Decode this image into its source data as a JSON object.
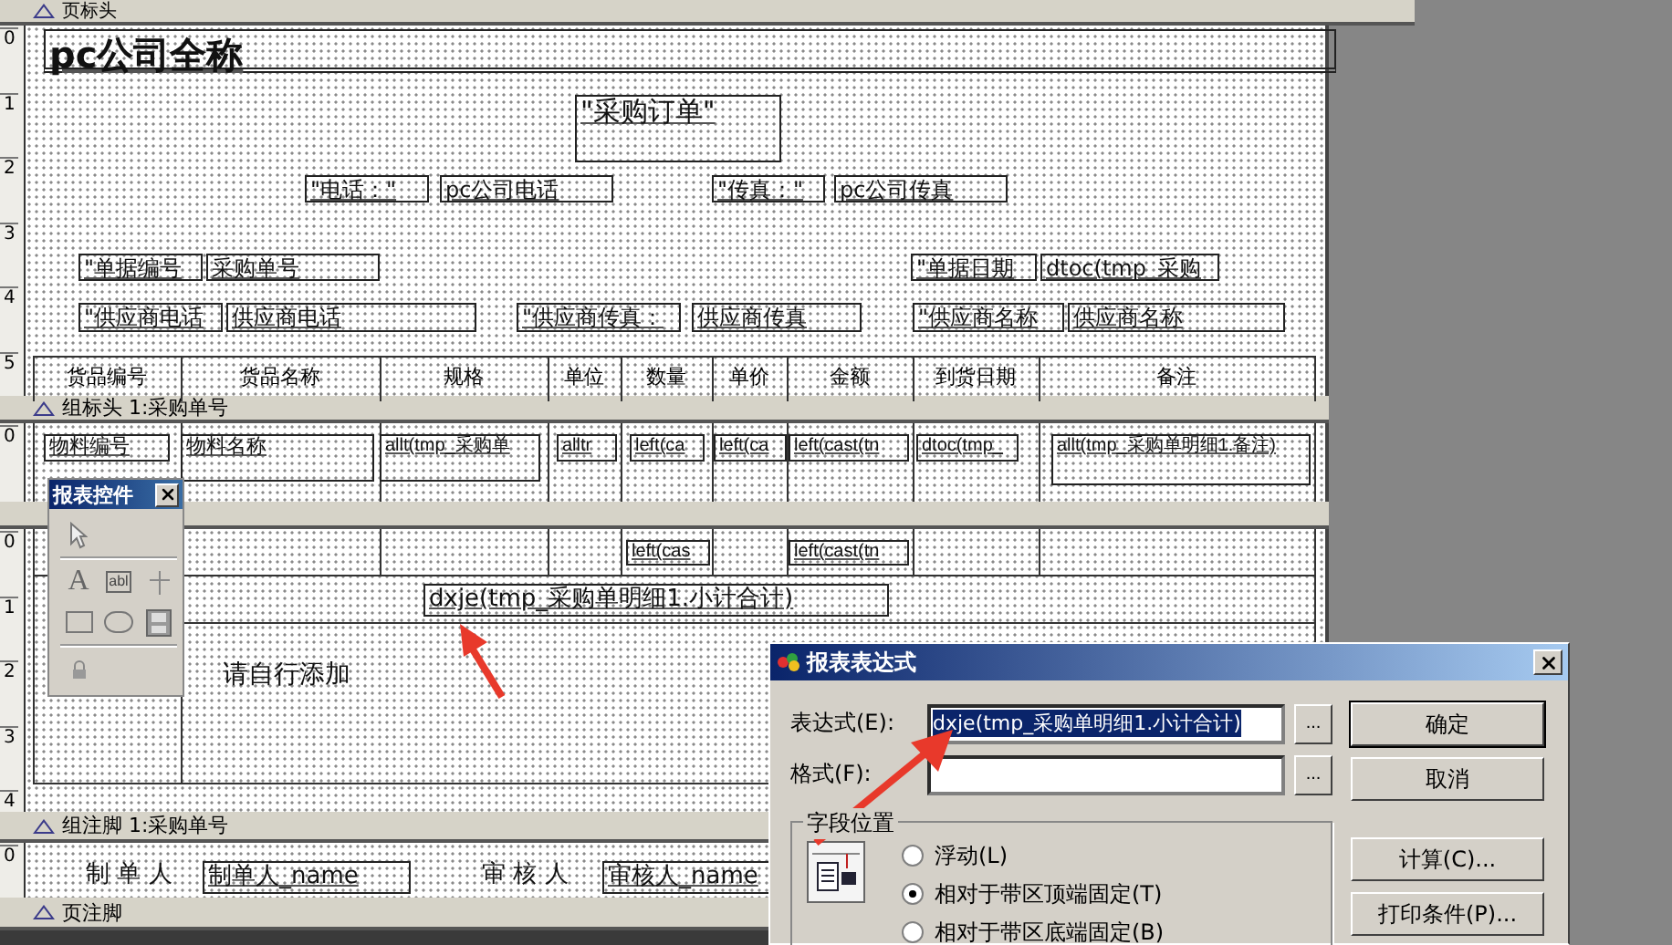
{
  "bands": [
    {
      "kind": "page_header",
      "bar_label": "页标头",
      "ruler": [
        "0",
        "1",
        "2",
        "3",
        "4",
        "5"
      ],
      "objects": [
        {
          "kind": "title",
          "text": "pc公司全称"
        },
        {
          "kind": "label",
          "text": "\"采购订单\""
        },
        {
          "kind": "label",
          "text": "\"电话：\""
        },
        {
          "kind": "field",
          "text": "pc公司电话"
        },
        {
          "kind": "label",
          "text": "\"传真：\""
        },
        {
          "kind": "field",
          "text": "pc公司传真"
        },
        {
          "kind": "label",
          "text": "\"单据编号"
        },
        {
          "kind": "field",
          "text": "采购单号"
        },
        {
          "kind": "label",
          "text": "\"单据日期"
        },
        {
          "kind": "field",
          "text": "dtoc(tmp_采购"
        },
        {
          "kind": "label",
          "text": "\"供应商电话"
        },
        {
          "kind": "field",
          "text": "供应商电话"
        },
        {
          "kind": "label",
          "text": "\"供应商传真："
        },
        {
          "kind": "field",
          "text": "供应商传真"
        },
        {
          "kind": "label",
          "text": "\"供应商名称"
        },
        {
          "kind": "field",
          "text": "供应商名称"
        }
      ],
      "columns": [
        "货品编号",
        "货品名称",
        "规格",
        "单位",
        "数量",
        "单价",
        "金额",
        "到货日期",
        "备注"
      ]
    },
    {
      "kind": "group_header",
      "bar_label": "组标头 1:采购单号",
      "ruler": [
        "0"
      ],
      "objects": [
        {
          "kind": "field",
          "text": "物料编号"
        },
        {
          "kind": "field",
          "text": "物料名称"
        },
        {
          "kind": "field",
          "text": "allt(tmp_采购单"
        },
        {
          "kind": "field",
          "text": "alltr"
        },
        {
          "kind": "field",
          "text": "left(ca"
        },
        {
          "kind": "field",
          "text": "left(ca"
        },
        {
          "kind": "field",
          "text": "left(cast(tn"
        },
        {
          "kind": "field",
          "text": "dtoc(tmp_"
        },
        {
          "kind": "field",
          "text": "allt(tmp_采购单明细1.备注)"
        }
      ]
    },
    {
      "kind": "detail",
      "ruler": [
        "0",
        "1",
        "2",
        "3",
        "4"
      ],
      "objects": [
        {
          "kind": "field",
          "text": "left(cas"
        },
        {
          "kind": "field",
          "text": "left(cast(tn"
        },
        {
          "kind": "field",
          "text": "dxje(tmp_采购单明细1.小计合计)"
        },
        {
          "kind": "text",
          "text": "请自行添加"
        }
      ]
    },
    {
      "kind": "group_footer",
      "bar_label": "组注脚 1:采购单号",
      "ruler": [
        "0"
      ],
      "objects": [
        {
          "kind": "text",
          "text": "制 单 人"
        },
        {
          "kind": "field",
          "text": "制单人_name"
        },
        {
          "kind": "text",
          "text": "审 核 人"
        },
        {
          "kind": "field",
          "text": "审核人_name"
        }
      ]
    },
    {
      "kind": "page_footer",
      "bar_label": "页注脚"
    }
  ],
  "toolbox": {
    "title": "报表控件",
    "tools": [
      {
        "kind": "pointer"
      },
      {
        "kind": "label",
        "glyph": "A"
      },
      {
        "kind": "field",
        "glyph": "abl"
      },
      {
        "kind": "line"
      },
      {
        "kind": "rectangle"
      },
      {
        "kind": "rounded_rectangle"
      },
      {
        "kind": "picture"
      },
      {
        "kind": "lock"
      }
    ]
  },
  "dialog": {
    "title": "报表表达式",
    "rows": [
      {
        "label": "表达式(E):",
        "value": "dxje(tmp_采购单明细1.小计合计)",
        "selected": true,
        "browse": "..."
      },
      {
        "label": "格式(F):",
        "browse": "..."
      }
    ],
    "group": {
      "legend": "字段位置",
      "options": [
        {
          "label": "浮动(L)",
          "selected": false
        },
        {
          "label": "相对于带区顶端固定(T)",
          "selected": true
        },
        {
          "label": "相对于带区底端固定(B)",
          "selected": false
        }
      ]
    },
    "buttons": [
      {
        "label": "确定",
        "default": true
      },
      {
        "label": "取消",
        "default": false
      },
      {
        "label": "计算(C)...",
        "default": false
      },
      {
        "label": "打印条件(P)...",
        "default": false
      }
    ]
  }
}
